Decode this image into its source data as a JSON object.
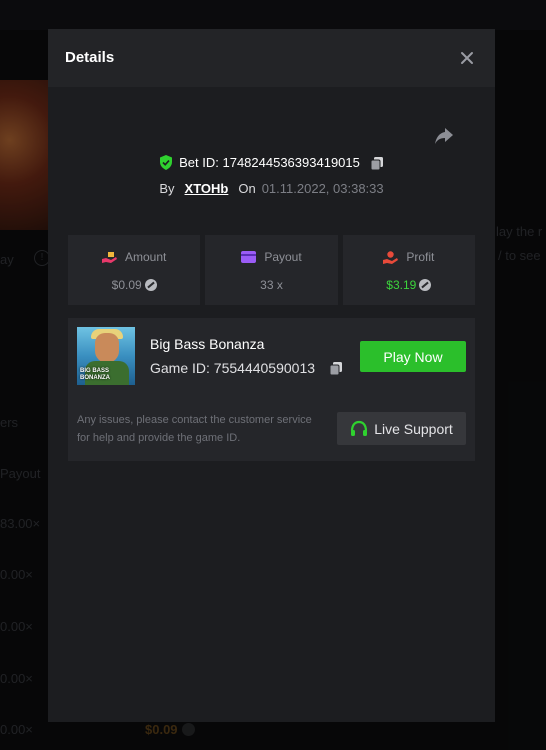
{
  "background": {
    "left_texts": [
      "ay",
      "ers",
      "Payout",
      "83.00×",
      "0.00×",
      "0.00×",
      "0.00×",
      "0.00×"
    ],
    "right_texts": [
      "lay the r",
      "/ to see"
    ],
    "amount": "$0.09"
  },
  "modal": {
    "title": "Details",
    "bet_id_label": "Bet ID: 1748244536393419015",
    "by_label": "By",
    "username": "XTOHb",
    "on_label": "On",
    "datetime": "01.11.2022, 03:38:33",
    "stats": [
      {
        "label": "Amount",
        "value": "$0.09",
        "icon": "money-hand-icon",
        "icon_color": "#e8396b"
      },
      {
        "label": "Payout",
        "value": "33 x",
        "icon": "card-icon",
        "icon_color": "#9b5cf6"
      },
      {
        "label": "Profit",
        "value": "$3.19",
        "icon": "profit-hand-icon",
        "icon_color": "#e84a3a"
      }
    ],
    "game": {
      "name": "Big Bass Bonanza",
      "game_id_label": "Game ID: 7554440590013",
      "play_label": "Play Now",
      "image_text_line1": "BIG BASS",
      "image_text_line2": "BONANZA",
      "issues_text": "Any issues, please contact the customer service for help and provide the game ID.",
      "support_label": "Live Support"
    }
  },
  "colors": {
    "accent_green": "#2bbf2b",
    "profit_green": "#3cd43c",
    "shield_green": "#2fd12f"
  }
}
